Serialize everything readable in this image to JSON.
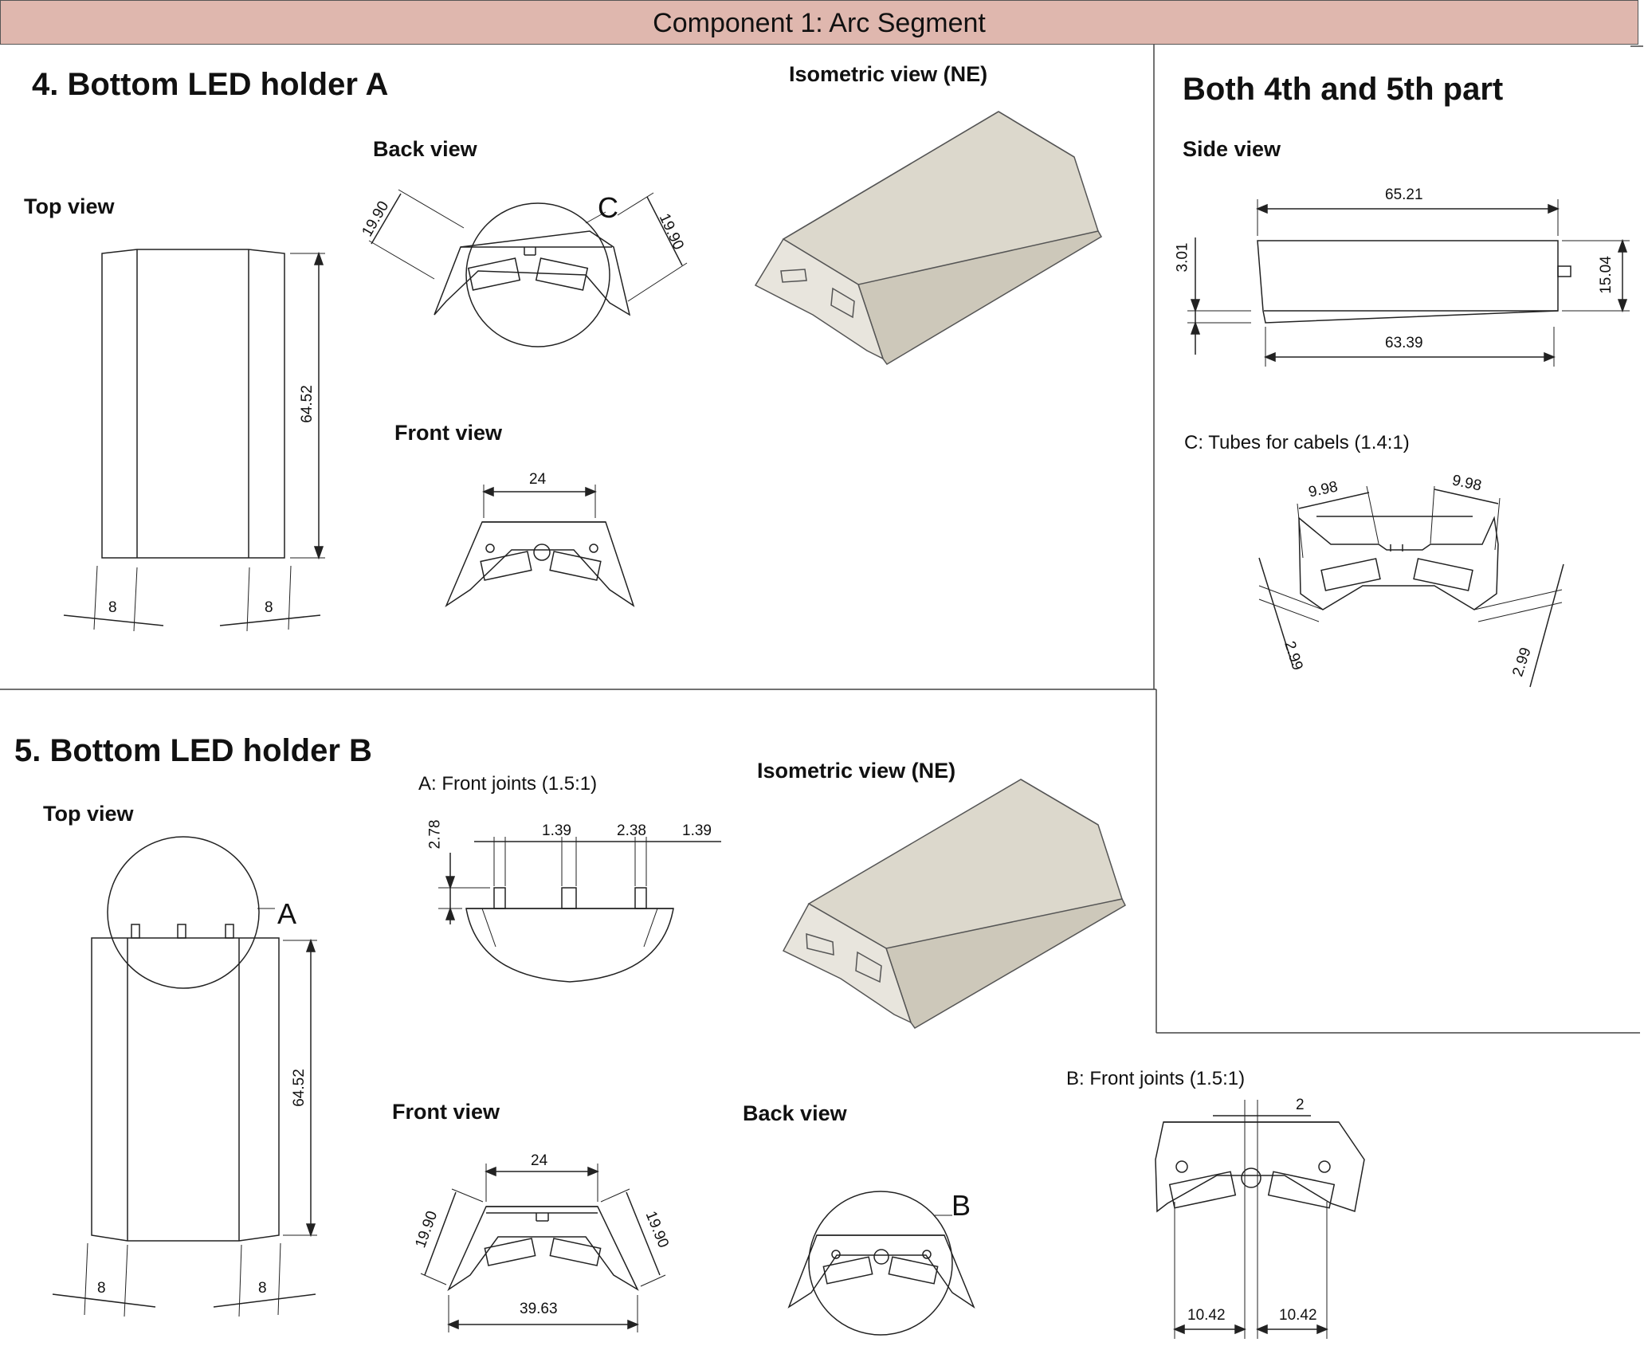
{
  "header": {
    "title": "Component 1: Arc Segment"
  },
  "part4": {
    "title": "4. Bottom LED holder A",
    "top_view": {
      "label": "Top view",
      "dims": {
        "length": "64.52",
        "left_bevel": "8",
        "right_bevel": "8"
      }
    },
    "back_view": {
      "label": "Back view",
      "dims": {
        "left": "19.90",
        "right": "19.90"
      },
      "callout": "C"
    },
    "front_view": {
      "label": "Front view",
      "dims": {
        "top": "24"
      }
    },
    "iso_view": {
      "label": "Isometric view (NE)"
    }
  },
  "part5": {
    "title": "5. Bottom LED holder B",
    "top_view": {
      "label": "Top view",
      "callout": "A",
      "dims": {
        "length": "64.52",
        "left_bevel": "8",
        "right_bevel": "8"
      }
    },
    "detail_a": {
      "label": "A: Front joints (1.5:1)",
      "dims": {
        "height": "2.78",
        "gap1": "1.39",
        "gap2": "2.38",
        "gap3": "1.39"
      }
    },
    "iso_view": {
      "label": "Isometric view (NE)"
    },
    "front_view": {
      "label": "Front view",
      "dims": {
        "top": "24",
        "left": "19.90",
        "right": "19.90",
        "bottom": "39.63"
      }
    },
    "back_view": {
      "label": "Back view",
      "callout": "B"
    },
    "detail_b": {
      "label": "B: Front joints (1.5:1)",
      "dims": {
        "gap": "2",
        "left": "10.42",
        "right": "10.42"
      }
    }
  },
  "both": {
    "title": "Both 4th and 5th part",
    "side_view": {
      "label": "Side view",
      "dims": {
        "top": "65.21",
        "bottom": "63.39",
        "left": "3.01",
        "right": "15.04"
      }
    },
    "detail_c": {
      "label": "C: Tubes for cabels (1.4:1)",
      "dims": {
        "top_left": "9.98",
        "top_right": "9.98",
        "bottom_left": "2.99",
        "bottom_right": "2.99"
      }
    }
  },
  "colors": {
    "header_bg": "#dfb7ae",
    "iso_face": "#dcd8cc",
    "iso_side": "#c9c4b6"
  }
}
